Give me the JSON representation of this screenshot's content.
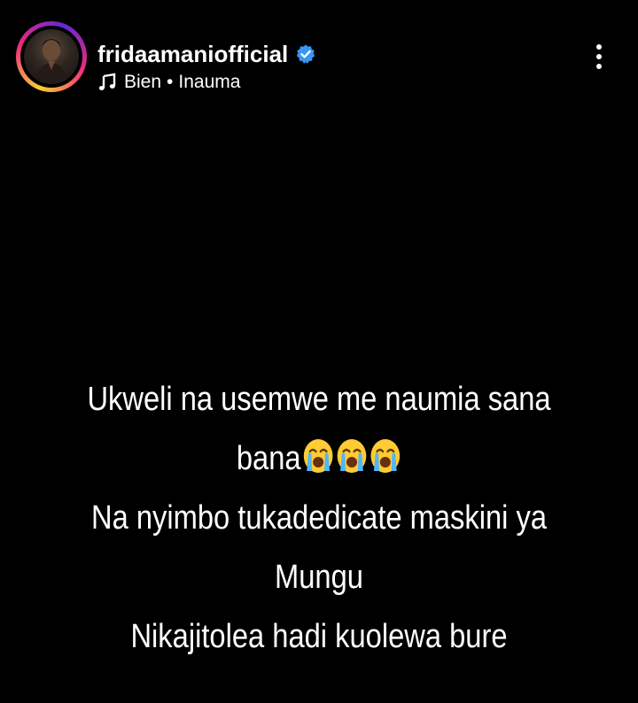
{
  "header": {
    "username": "fridaamaniofficial",
    "verified_icon": "verified-badge-icon",
    "music": {
      "icon": "music-note-icon",
      "artist": "Bien",
      "separator": "•",
      "song": "Inauma"
    },
    "more_icon": "more-vertical-icon"
  },
  "caption": {
    "line1": "Ukweli na usemwe me naumia sana",
    "line2": "bana",
    "line2_emojis": [
      "loudly-crying-face",
      "loudly-crying-face",
      "loudly-crying-face"
    ],
    "line3": "Na nyimbo tukadedicate maskini ya",
    "line4": "Mungu",
    "line5": "Nikajitolea hadi kuolewa bure"
  },
  "colors": {
    "background": "#000000",
    "text": "#ffffff",
    "verified": "#3897f0",
    "emoji_face": "#ffcc33",
    "emoji_tears": "#4fb6ff"
  }
}
